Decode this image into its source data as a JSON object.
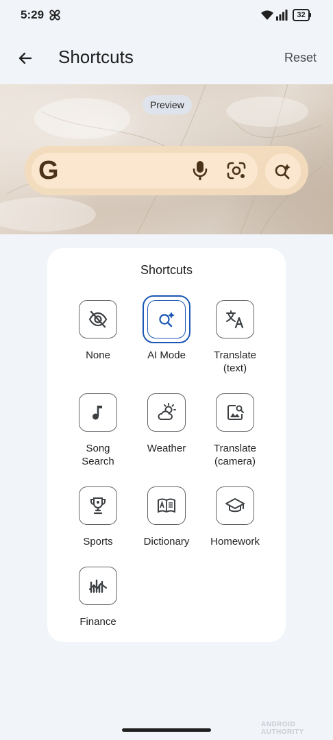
{
  "status_bar": {
    "time": "5:29",
    "battery": "32"
  },
  "app_bar": {
    "title": "Shortcuts",
    "reset_label": "Reset"
  },
  "preview": {
    "chip_label": "Preview",
    "search_logo": "G"
  },
  "card": {
    "title": "Shortcuts",
    "options": [
      {
        "label1": "None",
        "label2": "",
        "icon": "eye-off-icon",
        "selected": false
      },
      {
        "label1": "AI Mode",
        "label2": "",
        "icon": "ai-mode-icon",
        "selected": true
      },
      {
        "label1": "Translate",
        "label2": "(text)",
        "icon": "translate-icon",
        "selected": false
      },
      {
        "label1": "Song",
        "label2": "Search",
        "icon": "music-note-icon",
        "selected": false
      },
      {
        "label1": "Weather",
        "label2": "",
        "icon": "weather-icon",
        "selected": false
      },
      {
        "label1": "Translate",
        "label2": "(camera)",
        "icon": "image-search-icon",
        "selected": false
      },
      {
        "label1": "Sports",
        "label2": "",
        "icon": "trophy-icon",
        "selected": false
      },
      {
        "label1": "Dictionary",
        "label2": "",
        "icon": "book-icon",
        "selected": false
      },
      {
        "label1": "Homework",
        "label2": "",
        "icon": "graduation-cap-icon",
        "selected": false
      },
      {
        "label1": "Finance",
        "label2": "",
        "icon": "chart-icon",
        "selected": false
      }
    ]
  },
  "colors": {
    "accent": "#1a56b4",
    "background": "#f1f4f9",
    "search_pill": "#fbe7cf"
  },
  "watermark": "ANDROID AUTHORITY"
}
